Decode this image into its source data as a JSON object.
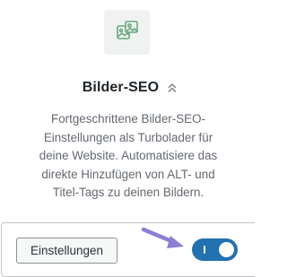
{
  "module": {
    "icon": "images-icon",
    "title": "Bilder-SEO",
    "collapse_icon": "chevron-double-up-icon",
    "description_lines": [
      "Fortgeschrittene Bilder-SEO-",
      "Einstellungen als Turbolader für",
      "deine Website. Automatisiere das",
      "direkte Hinzufügen von ALT- und",
      "Titel-Tags zu deinen Bildern."
    ]
  },
  "footer": {
    "settings_label": "Einstellungen",
    "toggle": {
      "state": "on",
      "color": "#2271b1"
    },
    "pointer_arrow": {
      "icon": "arrow-icon",
      "color": "#8b7fd6"
    }
  },
  "colors": {
    "icon_green": "#6aa882",
    "icon_bg": "#f0f2f1",
    "title": "#1d2327",
    "text": "#646970"
  }
}
